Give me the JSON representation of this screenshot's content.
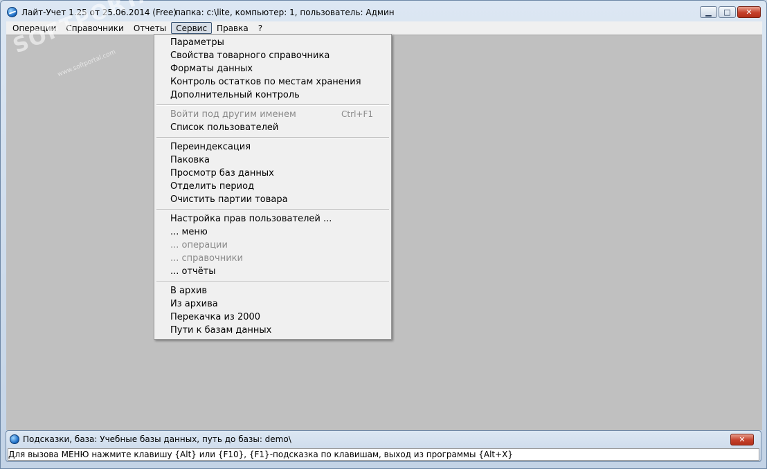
{
  "window": {
    "title": "Лайт-Учет 1.25 от 25.06.2014 (Free)",
    "info": "папка: c:\\lite, компьютер: 1, пользователь: Админ",
    "minimize_glyph": "▁",
    "maximize_glyph": "□",
    "close_glyph": "✕"
  },
  "menubar": {
    "items": [
      "Операции",
      "Справочники",
      "Отчеты",
      "Сервис",
      "Правка",
      "?"
    ],
    "active": "Сервис"
  },
  "watermark": {
    "text": "SOFTPORTAL",
    "url": "www.softportal.com"
  },
  "dropdown": {
    "groups": [
      {
        "items": [
          {
            "label": "Параметры",
            "enabled": true
          },
          {
            "label": "Свойства товарного справочника",
            "enabled": true
          },
          {
            "label": "Форматы данных",
            "enabled": true
          },
          {
            "label": "Контроль остатков по местам хранения",
            "enabled": true
          },
          {
            "label": "Дополнительный контроль",
            "enabled": true
          }
        ]
      },
      {
        "items": [
          {
            "label": "Войти под другим именем",
            "enabled": false,
            "shortcut": "Ctrl+F1"
          },
          {
            "label": "Список пользователей",
            "enabled": true
          }
        ]
      },
      {
        "items": [
          {
            "label": "Переиндексация",
            "enabled": true
          },
          {
            "label": "Паковка",
            "enabled": true
          },
          {
            "label": "Просмотр баз данных",
            "enabled": true
          },
          {
            "label": "Отделить период",
            "enabled": true
          },
          {
            "label": "Очистить партии товара",
            "enabled": true
          }
        ]
      },
      {
        "items": [
          {
            "label": "Настройка прав пользователей ...",
            "enabled": true
          },
          {
            "label": "... меню",
            "enabled": true
          },
          {
            "label": "... операции",
            "enabled": false
          },
          {
            "label": "... справочники",
            "enabled": false
          },
          {
            "label": "... отчёты",
            "enabled": true
          }
        ]
      },
      {
        "items": [
          {
            "label": "В архив",
            "enabled": true
          },
          {
            "label": "Из архива",
            "enabled": true
          },
          {
            "label": "Перекачка из 2000",
            "enabled": true
          },
          {
            "label": "Пути к базам данных",
            "enabled": true
          }
        ]
      }
    ]
  },
  "hints": {
    "title": "Подсказки, база: Учебные базы данных, путь до базы: demo\\",
    "close_glyph": "✕",
    "text": "Для вызова МЕНЮ нажмите клавишу {Alt} или {F10}, {F1}-подсказка по клавишам, выход из программы {Alt+X}"
  }
}
